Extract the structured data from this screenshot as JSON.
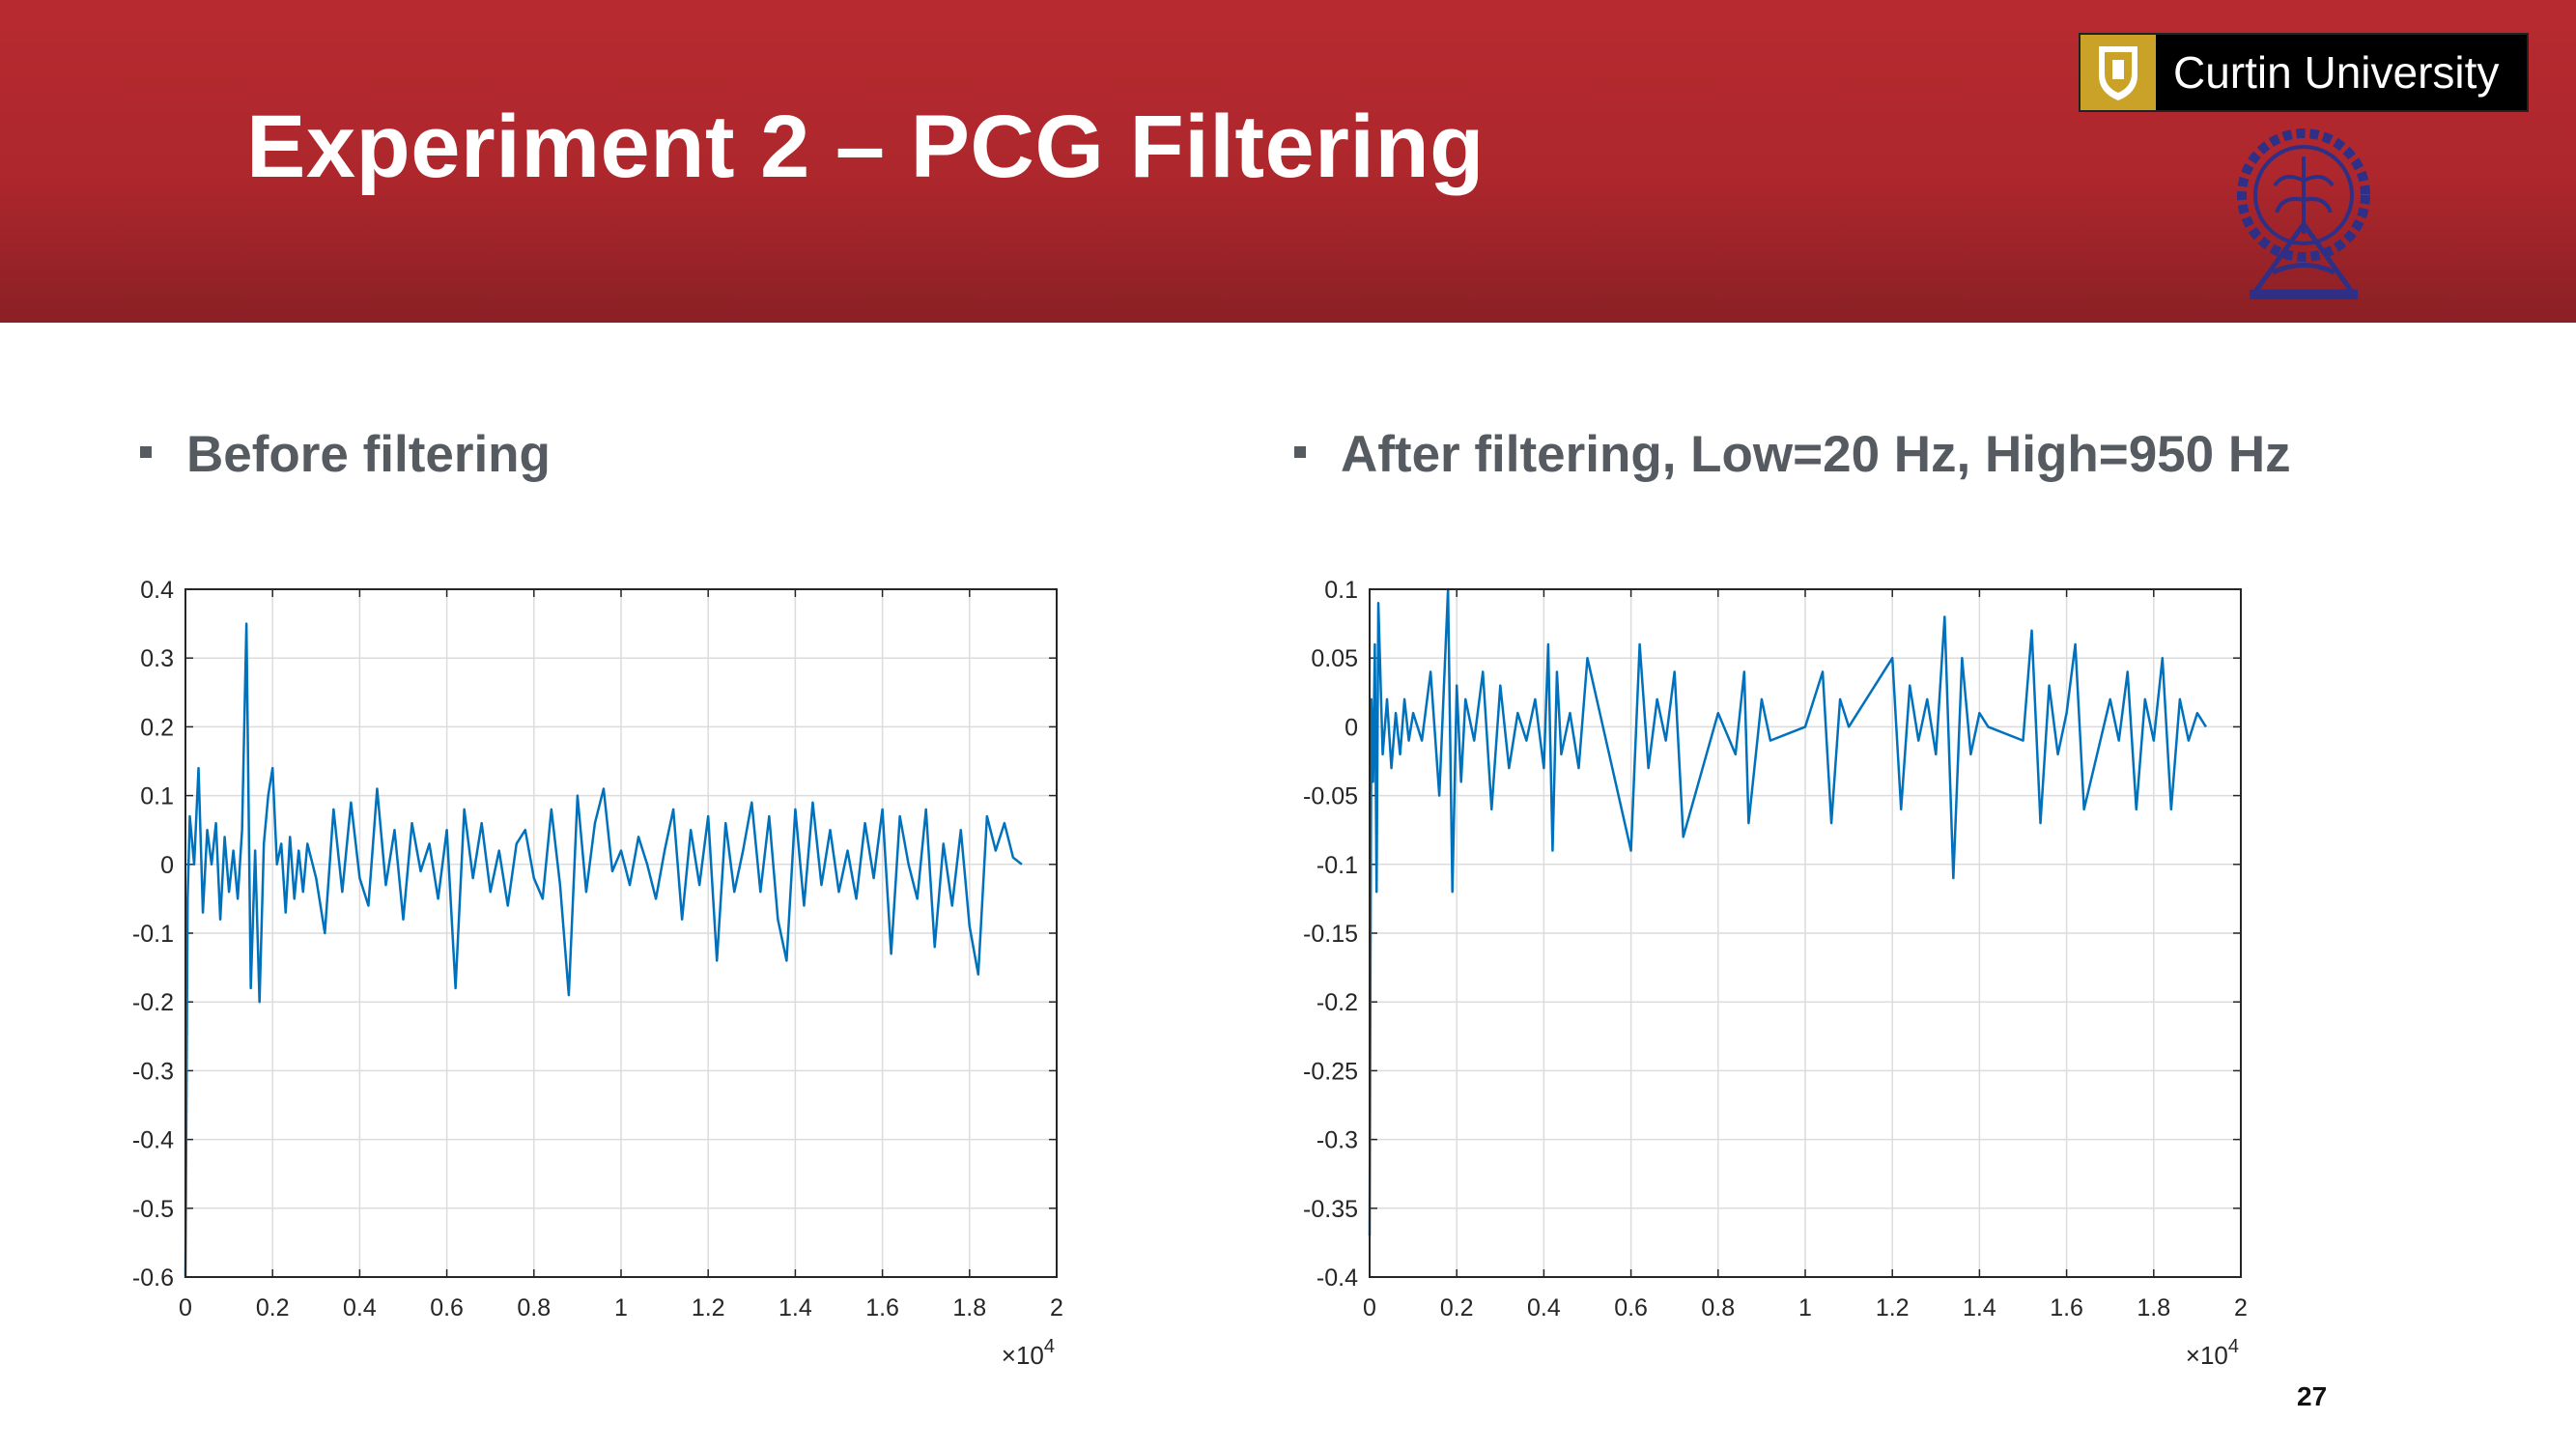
{
  "slide": {
    "title": "Experiment 2 – PCG Filtering",
    "logo_text": "Curtin University",
    "page_number": "27",
    "colors": {
      "header": "#b72a30",
      "series": "#0072bd",
      "emblem": "#2f2f86"
    }
  },
  "bullets": [
    "Before filtering",
    "After filtering, Low=20 Hz, High=950 Hz"
  ],
  "chart_data": [
    {
      "type": "line",
      "title": "",
      "xlabel": "",
      "ylabel": "",
      "x_multiplier": "×10",
      "x_multiplier_exp": "4",
      "xlim": [
        0,
        2
      ],
      "ylim": [
        -0.6,
        0.4
      ],
      "grid": true,
      "xticks": [
        "0",
        "0.2",
        "0.4",
        "0.6",
        "0.8",
        "1",
        "1.2",
        "1.4",
        "1.6",
        "1.8",
        "2"
      ],
      "yticks": [
        "0.4",
        "0.3",
        "0.2",
        "0.1",
        "0",
        "-0.1",
        "-0.2",
        "-0.3",
        "-0.4",
        "-0.5",
        "-0.6"
      ],
      "series": [
        {
          "color": "#0072bd",
          "x": [
            0,
            0.005,
            0.01,
            0.02,
            0.03,
            0.04,
            0.05,
            0.06,
            0.07,
            0.08,
            0.09,
            0.1,
            0.11,
            0.12,
            0.13,
            0.14,
            0.15,
            0.16,
            0.17,
            0.18,
            0.19,
            0.2,
            0.21,
            0.22,
            0.23,
            0.24,
            0.25,
            0.26,
            0.27,
            0.28,
            0.3,
            0.32,
            0.34,
            0.36,
            0.38,
            0.4,
            0.42,
            0.44,
            0.46,
            0.48,
            0.5,
            0.52,
            0.54,
            0.56,
            0.58,
            0.6,
            0.62,
            0.64,
            0.66,
            0.68,
            0.7,
            0.72,
            0.74,
            0.76,
            0.78,
            0.8,
            0.82,
            0.84,
            0.86,
            0.88,
            0.9,
            0.92,
            0.94,
            0.96,
            0.98,
            1.0,
            1.02,
            1.04,
            1.06,
            1.08,
            1.1,
            1.12,
            1.14,
            1.16,
            1.18,
            1.2,
            1.22,
            1.24,
            1.26,
            1.28,
            1.3,
            1.32,
            1.34,
            1.36,
            1.38,
            1.4,
            1.42,
            1.44,
            1.46,
            1.48,
            1.5,
            1.52,
            1.54,
            1.56,
            1.58,
            1.6,
            1.62,
            1.64,
            1.66,
            1.68,
            1.7,
            1.72,
            1.74,
            1.76,
            1.78,
            1.8,
            1.82,
            1.84,
            1.86,
            1.88,
            1.9,
            1.92
          ],
          "y": [
            -0.6,
            -0.05,
            0.07,
            0.0,
            0.14,
            -0.07,
            0.05,
            0.0,
            0.06,
            -0.08,
            0.04,
            -0.04,
            0.02,
            -0.05,
            0.05,
            0.35,
            -0.18,
            0.02,
            -0.2,
            0.03,
            0.1,
            0.14,
            0.0,
            0.03,
            -0.07,
            0.04,
            -0.05,
            0.02,
            -0.04,
            0.03,
            -0.02,
            -0.1,
            0.08,
            -0.04,
            0.09,
            -0.02,
            -0.06,
            0.11,
            -0.03,
            0.05,
            -0.08,
            0.06,
            -0.01,
            0.03,
            -0.05,
            0.05,
            -0.18,
            0.08,
            -0.02,
            0.06,
            -0.04,
            0.02,
            -0.06,
            0.03,
            0.05,
            -0.02,
            -0.05,
            0.08,
            -0.03,
            -0.19,
            0.1,
            -0.04,
            0.06,
            0.11,
            -0.01,
            0.02,
            -0.03,
            0.04,
            0.0,
            -0.05,
            0.02,
            0.08,
            -0.08,
            0.05,
            -0.03,
            0.07,
            -0.14,
            0.06,
            -0.04,
            0.02,
            0.09,
            -0.04,
            0.07,
            -0.08,
            -0.14,
            0.08,
            -0.06,
            0.09,
            -0.03,
            0.05,
            -0.04,
            0.02,
            -0.05,
            0.06,
            -0.02,
            0.08,
            -0.13,
            0.07,
            0.0,
            -0.05,
            0.08,
            -0.12,
            0.03,
            -0.06,
            0.05,
            -0.09,
            -0.16,
            0.07,
            0.02,
            0.06,
            0.01,
            0.0
          ]
        }
      ]
    },
    {
      "type": "line",
      "title": "",
      "xlabel": "",
      "ylabel": "",
      "x_multiplier": "×10",
      "x_multiplier_exp": "4",
      "xlim": [
        0,
        2
      ],
      "ylim": [
        -0.4,
        0.1
      ],
      "grid": true,
      "xticks": [
        "0",
        "0.2",
        "0.4",
        "0.6",
        "0.8",
        "1",
        "1.2",
        "1.4",
        "1.6",
        "1.8",
        "2"
      ],
      "yticks": [
        "0.1",
        "0.05",
        "0",
        "-0.05",
        "-0.1",
        "-0.15",
        "-0.2",
        "-0.25",
        "-0.3",
        "-0.35",
        "-0.4"
      ],
      "series": [
        {
          "color": "#0072bd",
          "x": [
            0,
            0.004,
            0.008,
            0.012,
            0.016,
            0.02,
            0.03,
            0.04,
            0.05,
            0.06,
            0.07,
            0.08,
            0.09,
            0.1,
            0.12,
            0.14,
            0.16,
            0.18,
            0.19,
            0.2,
            0.21,
            0.22,
            0.24,
            0.26,
            0.28,
            0.3,
            0.32,
            0.34,
            0.36,
            0.38,
            0.4,
            0.41,
            0.42,
            0.43,
            0.44,
            0.46,
            0.48,
            0.5,
            0.6,
            0.62,
            0.64,
            0.66,
            0.68,
            0.7,
            0.72,
            0.8,
            0.84,
            0.86,
            0.87,
            0.9,
            0.92,
            1.0,
            1.04,
            1.06,
            1.08,
            1.1,
            1.2,
            1.22,
            1.24,
            1.26,
            1.28,
            1.3,
            1.32,
            1.34,
            1.36,
            1.38,
            1.4,
            1.42,
            1.5,
            1.52,
            1.54,
            1.56,
            1.58,
            1.6,
            1.62,
            1.64,
            1.7,
            1.72,
            1.74,
            1.76,
            1.78,
            1.8,
            1.82,
            1.84,
            1.86,
            1.88,
            1.9,
            1.92
          ],
          "y": [
            -0.37,
            0.02,
            -0.04,
            0.06,
            -0.12,
            0.09,
            -0.02,
            0.02,
            -0.03,
            0.01,
            -0.02,
            0.02,
            -0.01,
            0.01,
            -0.01,
            0.04,
            -0.05,
            0.1,
            -0.12,
            0.03,
            -0.04,
            0.02,
            -0.01,
            0.04,
            -0.06,
            0.03,
            -0.03,
            0.01,
            -0.01,
            0.02,
            -0.03,
            0.06,
            -0.09,
            0.04,
            -0.02,
            0.01,
            -0.03,
            0.05,
            -0.09,
            0.06,
            -0.03,
            0.02,
            -0.01,
            0.04,
            -0.08,
            0.01,
            -0.02,
            0.04,
            -0.07,
            0.02,
            -0.01,
            0.0,
            0.04,
            -0.07,
            0.02,
            0.0,
            0.05,
            -0.06,
            0.03,
            -0.01,
            0.02,
            -0.02,
            0.08,
            -0.11,
            0.05,
            -0.02,
            0.01,
            0.0,
            -0.01,
            0.07,
            -0.07,
            0.03,
            -0.02,
            0.01,
            0.06,
            -0.06,
            0.02,
            -0.01,
            0.04,
            -0.06,
            0.02,
            -0.01,
            0.05,
            -0.06,
            0.02,
            -0.01,
            0.01,
            0.0
          ]
        }
      ]
    }
  ]
}
